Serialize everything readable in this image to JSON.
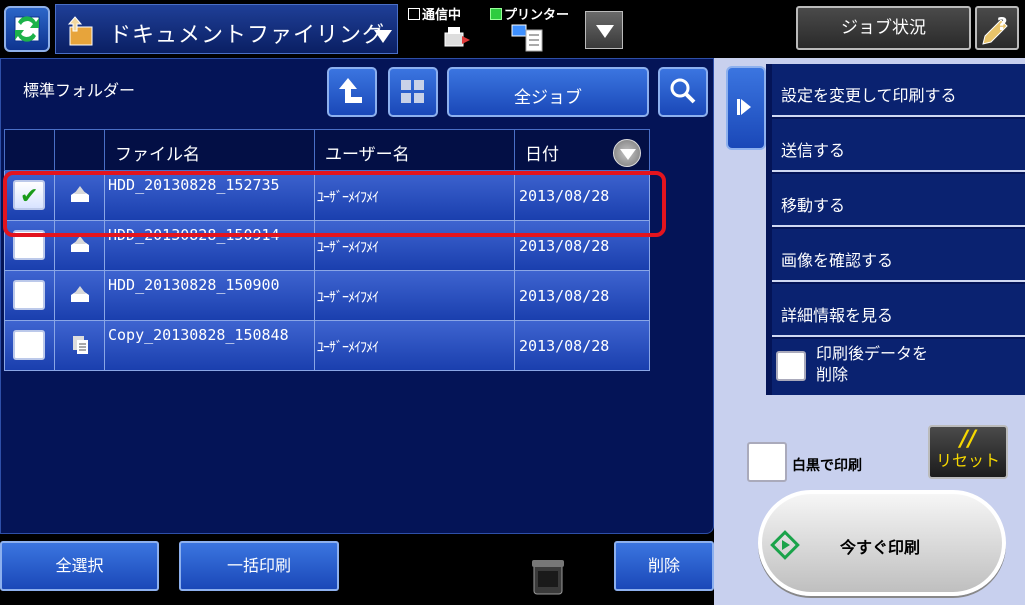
{
  "header": {
    "mode_title": "ドキュメントファイリング",
    "status_comm": "通信中",
    "status_printer": "プリンター",
    "job_status_label": "ジョブ状況"
  },
  "main": {
    "folder_label": "標準フォルダー",
    "all_jobs_label": "全ジョブ",
    "columns": [
      "ファイル名",
      "ユーザー名",
      "日付"
    ],
    "rows": [
      {
        "filename": "HDD_20130828_152735",
        "user": "ﾕｰｻﾞｰﾒｲﾌﾒｲ",
        "date": "2013/08/28",
        "checked": true,
        "icon": "hdd-file-icon"
      },
      {
        "filename": "HDD_20130828_150914",
        "user": "ﾕｰｻﾞｰﾒｲﾌﾒｲ",
        "date": "2013/08/28",
        "checked": false,
        "icon": "hdd-file-icon"
      },
      {
        "filename": "HDD_20130828_150900",
        "user": "ﾕｰｻﾞｰﾒｲﾌﾒｲ",
        "date": "2013/08/28",
        "checked": false,
        "icon": "hdd-file-icon"
      },
      {
        "filename": "Copy_20130828_150848",
        "user": "ﾕｰｻﾞｰﾒｲﾌﾒｲ",
        "date": "2013/08/28",
        "checked": false,
        "icon": "copy-file-icon"
      }
    ]
  },
  "bottom": {
    "select_all": "全選択",
    "batch_print": "一括印刷",
    "delete": "削除"
  },
  "side": {
    "actions": [
      "設定を変更して印刷する",
      "送信する",
      "移動する",
      "画像を確認する",
      "詳細情報を見る"
    ],
    "delete_after_print_line1": "印刷後データを",
    "delete_after_print_line2": "削除",
    "bw_print": "白黒で印刷",
    "reset_symbol": "//",
    "reset_label": "リセット",
    "print_now": "今すぐ印刷"
  }
}
